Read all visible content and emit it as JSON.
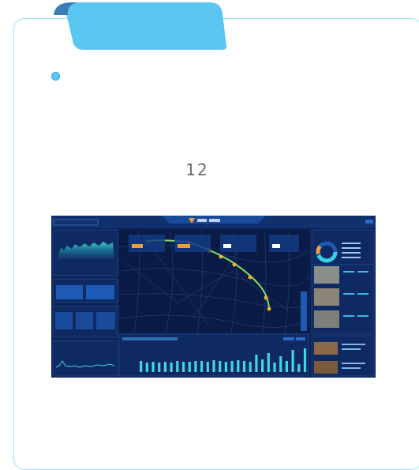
{
  "step": {
    "number": "12"
  },
  "colors": {
    "frame_border": "#9fdcf4",
    "tab_fill": "#5bc6f2",
    "tab_dark": "#3a7db5",
    "bullet": "#5bc6f2",
    "dashboard_bg": "#0c2152",
    "route_green": "#7ee06a",
    "bar_cyan": "#3fd6e8"
  },
  "dashboard": {
    "bar_values": [
      14,
      12,
      13,
      12,
      13,
      12,
      14,
      13,
      13,
      14,
      14,
      13,
      15,
      14,
      13,
      14,
      15,
      14,
      13,
      22,
      16,
      24,
      12,
      20,
      14,
      28,
      10,
      30
    ],
    "icons": [
      "logo-icon"
    ]
  }
}
